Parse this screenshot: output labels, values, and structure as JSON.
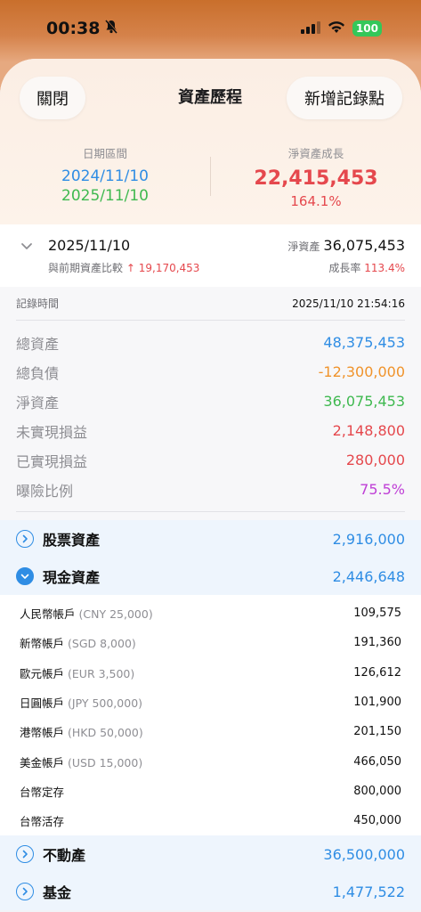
{
  "status": {
    "time": "00:38",
    "battery": "100"
  },
  "nav": {
    "close_label": "關閉",
    "title": "資產歷程",
    "add_label": "新增記錄點"
  },
  "summary": {
    "period_label": "日期區間",
    "start_date": "2024/11/10",
    "end_date": "2025/11/10",
    "growth_label": "淨資產成長",
    "growth_value": "22,415,453",
    "growth_pct": "164.1%"
  },
  "record": {
    "date": "2025/11/10",
    "compare_label": "與前期資產比較",
    "compare_arrow": "↑",
    "compare_value": "19,170,453",
    "net_label": "淨資產",
    "net_value": "36,075,453",
    "rate_label": "成長率",
    "rate_value": "113.4%"
  },
  "detail": {
    "time_label": "記錄時間",
    "time_value": "2025/11/10 21:54:16",
    "metrics": [
      {
        "label": "總資產",
        "value": "48,375,453",
        "color": "#2f8de4"
      },
      {
        "label": "總負債",
        "value": "-12,300,000",
        "color": "#f0932b"
      },
      {
        "label": "淨資產",
        "value": "36,075,453",
        "color": "#3fb950"
      },
      {
        "label": "未實現損益",
        "value": "2,148,800",
        "color": "#e5484d"
      },
      {
        "label": "已實現損益",
        "value": "280,000",
        "color": "#e5484d"
      },
      {
        "label": "曝險比例",
        "value": "75.5%",
        "color": "#bf3fd6"
      }
    ]
  },
  "categories": {
    "stock": {
      "label": "股票資產",
      "value": "2,916,000"
    },
    "cash": {
      "label": "現金資產",
      "value": "2,446,648"
    },
    "realestate": {
      "label": "不動產",
      "value": "36,500,000"
    },
    "fund": {
      "label": "基金",
      "value": "1,477,522"
    }
  },
  "cash_accounts": [
    {
      "label": "人民幣帳戶",
      "note": "(CNY 25,000)",
      "value": "109,575"
    },
    {
      "label": "新幣帳戶",
      "note": "(SGD 8,000)",
      "value": "191,360"
    },
    {
      "label": "歐元帳戶",
      "note": "(EUR 3,500)",
      "value": "126,612"
    },
    {
      "label": "日圓帳戶",
      "note": "(JPY 500,000)",
      "value": "101,900"
    },
    {
      "label": "港幣帳戶",
      "note": "(HKD 50,000)",
      "value": "201,150"
    },
    {
      "label": "美金帳戶",
      "note": "(USD 15,000)",
      "value": "466,050"
    },
    {
      "label": "台幣定存",
      "note": "",
      "value": "800,000"
    },
    {
      "label": "台幣活存",
      "note": "",
      "value": "450,000"
    }
  ]
}
